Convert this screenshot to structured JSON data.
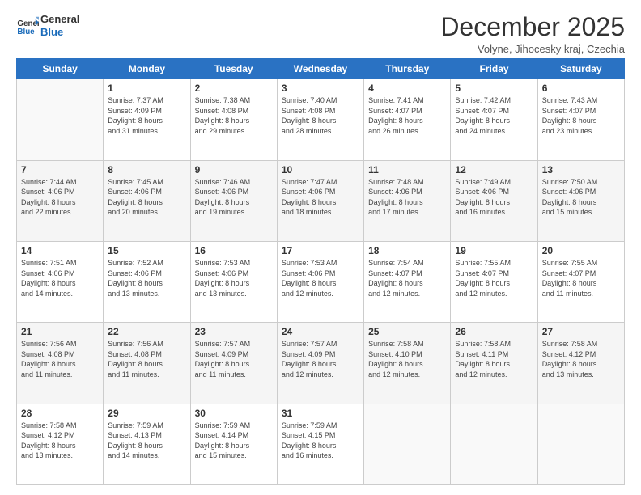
{
  "header": {
    "logo_line1": "General",
    "logo_line2": "Blue",
    "month_title": "December 2025",
    "location": "Volyne, Jihocesky kraj, Czechia"
  },
  "weekdays": [
    "Sunday",
    "Monday",
    "Tuesday",
    "Wednesday",
    "Thursday",
    "Friday",
    "Saturday"
  ],
  "weeks": [
    [
      {
        "day": "",
        "info": ""
      },
      {
        "day": "1",
        "info": "Sunrise: 7:37 AM\nSunset: 4:09 PM\nDaylight: 8 hours\nand 31 minutes."
      },
      {
        "day": "2",
        "info": "Sunrise: 7:38 AM\nSunset: 4:08 PM\nDaylight: 8 hours\nand 29 minutes."
      },
      {
        "day": "3",
        "info": "Sunrise: 7:40 AM\nSunset: 4:08 PM\nDaylight: 8 hours\nand 28 minutes."
      },
      {
        "day": "4",
        "info": "Sunrise: 7:41 AM\nSunset: 4:07 PM\nDaylight: 8 hours\nand 26 minutes."
      },
      {
        "day": "5",
        "info": "Sunrise: 7:42 AM\nSunset: 4:07 PM\nDaylight: 8 hours\nand 24 minutes."
      },
      {
        "day": "6",
        "info": "Sunrise: 7:43 AM\nSunset: 4:07 PM\nDaylight: 8 hours\nand 23 minutes."
      }
    ],
    [
      {
        "day": "7",
        "info": "Sunrise: 7:44 AM\nSunset: 4:06 PM\nDaylight: 8 hours\nand 22 minutes."
      },
      {
        "day": "8",
        "info": "Sunrise: 7:45 AM\nSunset: 4:06 PM\nDaylight: 8 hours\nand 20 minutes."
      },
      {
        "day": "9",
        "info": "Sunrise: 7:46 AM\nSunset: 4:06 PM\nDaylight: 8 hours\nand 19 minutes."
      },
      {
        "day": "10",
        "info": "Sunrise: 7:47 AM\nSunset: 4:06 PM\nDaylight: 8 hours\nand 18 minutes."
      },
      {
        "day": "11",
        "info": "Sunrise: 7:48 AM\nSunset: 4:06 PM\nDaylight: 8 hours\nand 17 minutes."
      },
      {
        "day": "12",
        "info": "Sunrise: 7:49 AM\nSunset: 4:06 PM\nDaylight: 8 hours\nand 16 minutes."
      },
      {
        "day": "13",
        "info": "Sunrise: 7:50 AM\nSunset: 4:06 PM\nDaylight: 8 hours\nand 15 minutes."
      }
    ],
    [
      {
        "day": "14",
        "info": "Sunrise: 7:51 AM\nSunset: 4:06 PM\nDaylight: 8 hours\nand 14 minutes."
      },
      {
        "day": "15",
        "info": "Sunrise: 7:52 AM\nSunset: 4:06 PM\nDaylight: 8 hours\nand 13 minutes."
      },
      {
        "day": "16",
        "info": "Sunrise: 7:53 AM\nSunset: 4:06 PM\nDaylight: 8 hours\nand 13 minutes."
      },
      {
        "day": "17",
        "info": "Sunrise: 7:53 AM\nSunset: 4:06 PM\nDaylight: 8 hours\nand 12 minutes."
      },
      {
        "day": "18",
        "info": "Sunrise: 7:54 AM\nSunset: 4:07 PM\nDaylight: 8 hours\nand 12 minutes."
      },
      {
        "day": "19",
        "info": "Sunrise: 7:55 AM\nSunset: 4:07 PM\nDaylight: 8 hours\nand 12 minutes."
      },
      {
        "day": "20",
        "info": "Sunrise: 7:55 AM\nSunset: 4:07 PM\nDaylight: 8 hours\nand 11 minutes."
      }
    ],
    [
      {
        "day": "21",
        "info": "Sunrise: 7:56 AM\nSunset: 4:08 PM\nDaylight: 8 hours\nand 11 minutes."
      },
      {
        "day": "22",
        "info": "Sunrise: 7:56 AM\nSunset: 4:08 PM\nDaylight: 8 hours\nand 11 minutes."
      },
      {
        "day": "23",
        "info": "Sunrise: 7:57 AM\nSunset: 4:09 PM\nDaylight: 8 hours\nand 11 minutes."
      },
      {
        "day": "24",
        "info": "Sunrise: 7:57 AM\nSunset: 4:09 PM\nDaylight: 8 hours\nand 12 minutes."
      },
      {
        "day": "25",
        "info": "Sunrise: 7:58 AM\nSunset: 4:10 PM\nDaylight: 8 hours\nand 12 minutes."
      },
      {
        "day": "26",
        "info": "Sunrise: 7:58 AM\nSunset: 4:11 PM\nDaylight: 8 hours\nand 12 minutes."
      },
      {
        "day": "27",
        "info": "Sunrise: 7:58 AM\nSunset: 4:12 PM\nDaylight: 8 hours\nand 13 minutes."
      }
    ],
    [
      {
        "day": "28",
        "info": "Sunrise: 7:58 AM\nSunset: 4:12 PM\nDaylight: 8 hours\nand 13 minutes."
      },
      {
        "day": "29",
        "info": "Sunrise: 7:59 AM\nSunset: 4:13 PM\nDaylight: 8 hours\nand 14 minutes."
      },
      {
        "day": "30",
        "info": "Sunrise: 7:59 AM\nSunset: 4:14 PM\nDaylight: 8 hours\nand 15 minutes."
      },
      {
        "day": "31",
        "info": "Sunrise: 7:59 AM\nSunset: 4:15 PM\nDaylight: 8 hours\nand 16 minutes."
      },
      {
        "day": "",
        "info": ""
      },
      {
        "day": "",
        "info": ""
      },
      {
        "day": "",
        "info": ""
      }
    ]
  ]
}
